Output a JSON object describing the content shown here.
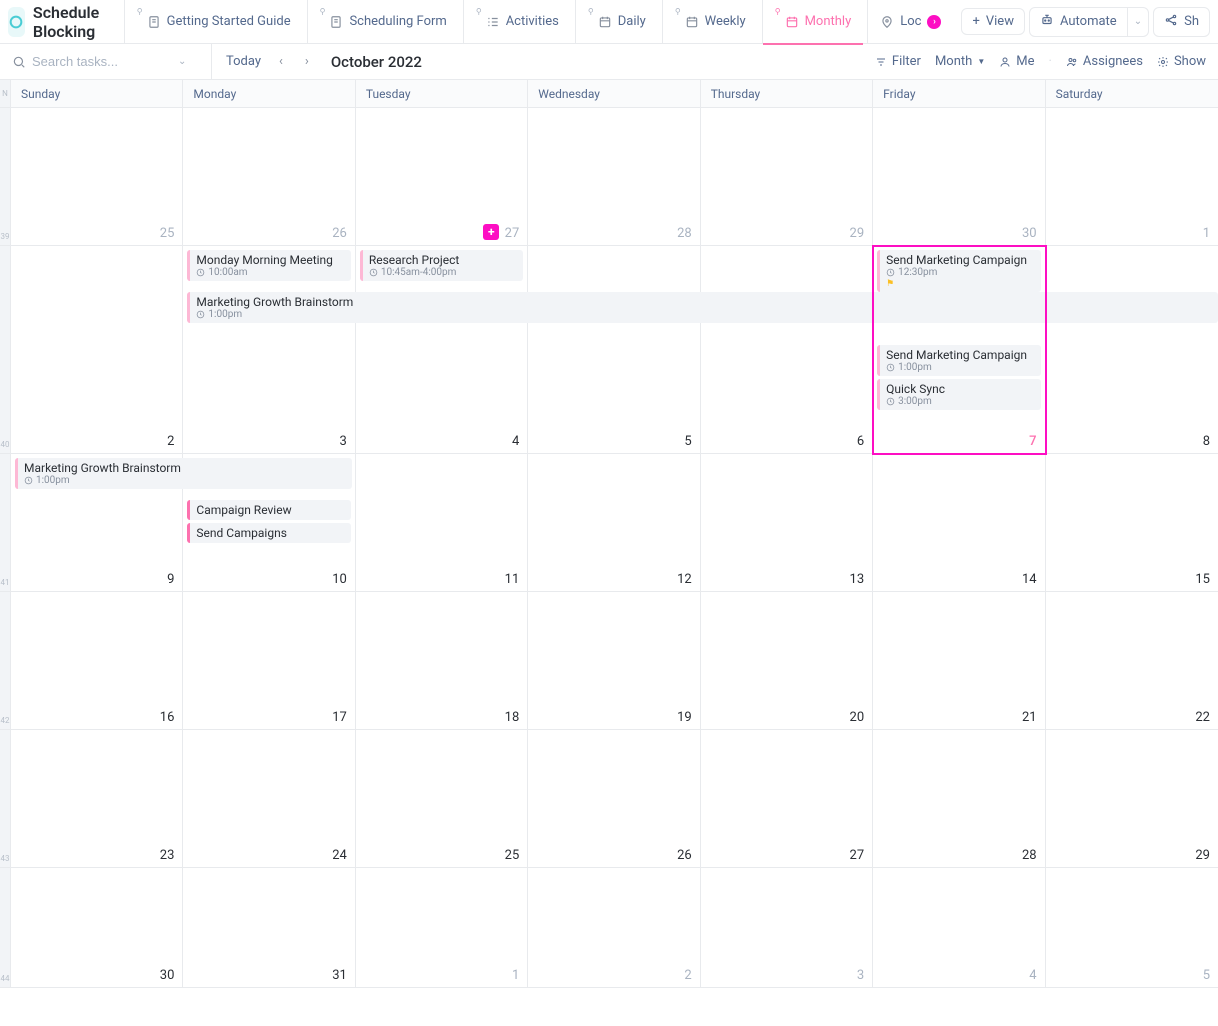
{
  "header": {
    "title": "Schedule Blocking",
    "tabs": [
      {
        "label": "Getting Started Guide",
        "icon": "doc-icon"
      },
      {
        "label": "Scheduling Form",
        "icon": "doc-icon"
      },
      {
        "label": "Activities",
        "icon": "list-icon"
      },
      {
        "label": "Daily",
        "icon": "cal-icon"
      },
      {
        "label": "Weekly",
        "icon": "cal-icon"
      },
      {
        "label": "Monthly",
        "icon": "cal-icon",
        "active": true
      },
      {
        "label": "Loc",
        "icon": "pin-icon",
        "badge": true
      }
    ],
    "view_btn": "View",
    "automate_btn": "Automate",
    "share_btn": "Sh"
  },
  "toolbar": {
    "search_placeholder": "Search tasks...",
    "today": "Today",
    "month_label": "October 2022",
    "filter": "Filter",
    "month_dd": "Month",
    "me": "Me",
    "assignees": "Assignees",
    "show": "Show"
  },
  "day_headers": [
    "Sunday",
    "Monday",
    "Tuesday",
    "Wednesday",
    "Thursday",
    "Friday",
    "Saturday"
  ],
  "week_col_label": "N",
  "weeks": [
    {
      "num": "39",
      "dates": [
        {
          "n": "25",
          "muted": true
        },
        {
          "n": "26",
          "muted": true
        },
        {
          "n": "27",
          "muted": true,
          "add": true
        },
        {
          "n": "28",
          "muted": true
        },
        {
          "n": "29",
          "muted": true
        },
        {
          "n": "30",
          "muted": true
        },
        {
          "n": "1",
          "muted": true
        }
      ]
    },
    {
      "num": "40",
      "dates": [
        {
          "n": "2"
        },
        {
          "n": "3"
        },
        {
          "n": "4"
        },
        {
          "n": "5"
        },
        {
          "n": "6"
        },
        {
          "n": "7",
          "today": true
        },
        {
          "n": "8"
        }
      ]
    },
    {
      "num": "41",
      "dates": [
        {
          "n": "9"
        },
        {
          "n": "10"
        },
        {
          "n": "11"
        },
        {
          "n": "12"
        },
        {
          "n": "13"
        },
        {
          "n": "14"
        },
        {
          "n": "15"
        }
      ]
    },
    {
      "num": "42",
      "dates": [
        {
          "n": "16"
        },
        {
          "n": "17"
        },
        {
          "n": "18"
        },
        {
          "n": "19"
        },
        {
          "n": "20"
        },
        {
          "n": "21"
        },
        {
          "n": "22"
        }
      ]
    },
    {
      "num": "43",
      "dates": [
        {
          "n": "23"
        },
        {
          "n": "24"
        },
        {
          "n": "25"
        },
        {
          "n": "26"
        },
        {
          "n": "27"
        },
        {
          "n": "28"
        },
        {
          "n": "29"
        }
      ]
    },
    {
      "num": "44",
      "dates": [
        {
          "n": "30"
        },
        {
          "n": "31"
        },
        {
          "n": "1",
          "muted": true
        },
        {
          "n": "2",
          "muted": true
        },
        {
          "n": "3",
          "muted": true
        },
        {
          "n": "4",
          "muted": true
        },
        {
          "n": "5",
          "muted": true
        }
      ]
    }
  ],
  "events": {
    "w1_mon": [
      {
        "title": "Monday Morning Meeting",
        "time": "10:00am",
        "light": true
      }
    ],
    "w1_tue": [
      {
        "title": "Research Project",
        "time": "10:45am-4:00pm",
        "light": true
      }
    ],
    "w1_mon_span": {
      "title": "Marketing Growth Brainstorm",
      "time": "1:00pm"
    },
    "w1_fri": [
      {
        "title": "Send Marketing Campaign",
        "time": "12:30pm",
        "light": true,
        "flag": true
      },
      {
        "title": "Send Marketing Campaign",
        "time": "1:00pm",
        "light": true,
        "_gap": true
      },
      {
        "title": "Quick Sync",
        "time": "3:00pm",
        "light": true
      }
    ],
    "w2_sun_span": {
      "title": "Marketing Growth Brainstorm",
      "time": "1:00pm"
    },
    "w2_mon": [
      {
        "title": "Campaign Review"
      },
      {
        "title": "Send Campaigns"
      }
    ]
  }
}
